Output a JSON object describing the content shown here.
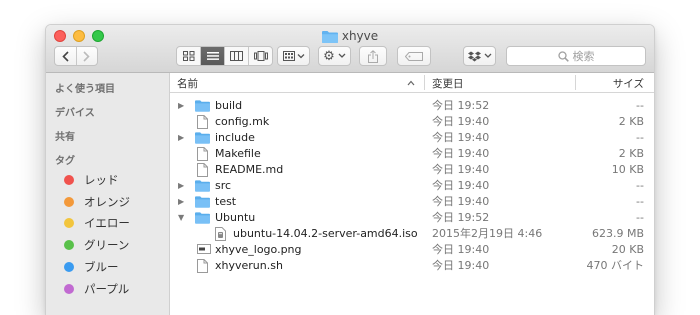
{
  "window": {
    "title": "xhyve"
  },
  "toolbar": {
    "search_placeholder": "検索",
    "view_modes": [
      "icon-view-icon",
      "list-view-icon",
      "column-view-icon",
      "cover-flow-icon"
    ],
    "active_view": "list-view-icon"
  },
  "sidebar": {
    "favorites_header": "よく使う項目",
    "devices_header": "デバイス",
    "shared_header": "共有",
    "tags_header": "タグ",
    "tags": [
      {
        "label": "レッド",
        "color": "#f0524d"
      },
      {
        "label": "オレンジ",
        "color": "#f3993a"
      },
      {
        "label": "イエロー",
        "color": "#f2c53d"
      },
      {
        "label": "グリーン",
        "color": "#59c14a"
      },
      {
        "label": "ブルー",
        "color": "#3a9bf0"
      },
      {
        "label": "パープル",
        "color": "#c16ad1"
      }
    ]
  },
  "columns": {
    "name": "名前",
    "date": "変更日",
    "size": "サイズ"
  },
  "files": [
    {
      "name": "build",
      "date": "今日 19:52",
      "size": "--",
      "kind": "folder",
      "expander": "closed",
      "indent": 0
    },
    {
      "name": "config.mk",
      "date": "今日 19:40",
      "size": "2 KB",
      "kind": "document",
      "expander": "none",
      "indent": 0
    },
    {
      "name": "include",
      "date": "今日 19:40",
      "size": "--",
      "kind": "folder",
      "expander": "closed",
      "indent": 0
    },
    {
      "name": "Makefile",
      "date": "今日 19:40",
      "size": "2 KB",
      "kind": "document",
      "expander": "none",
      "indent": 0
    },
    {
      "name": "README.md",
      "date": "今日 19:40",
      "size": "10 KB",
      "kind": "document",
      "expander": "none",
      "indent": 0
    },
    {
      "name": "src",
      "date": "今日 19:40",
      "size": "--",
      "kind": "folder",
      "expander": "closed",
      "indent": 0
    },
    {
      "name": "test",
      "date": "今日 19:40",
      "size": "--",
      "kind": "folder",
      "expander": "closed",
      "indent": 0
    },
    {
      "name": "Ubuntu",
      "date": "今日 19:52",
      "size": "--",
      "kind": "folder",
      "expander": "open",
      "indent": 0
    },
    {
      "name": "ubuntu-14.04.2-server-amd64.iso",
      "date": "2015年2月19日 4:46",
      "size": "623.9 MB",
      "kind": "disk-image",
      "expander": "none",
      "indent": 1
    },
    {
      "name": "xhyve_logo.png",
      "date": "今日 19:40",
      "size": "20 KB",
      "kind": "image",
      "expander": "none",
      "indent": 0
    },
    {
      "name": "xhyverun.sh",
      "date": "今日 19:40",
      "size": "470 バイト",
      "kind": "document",
      "expander": "none",
      "indent": 0
    }
  ]
}
